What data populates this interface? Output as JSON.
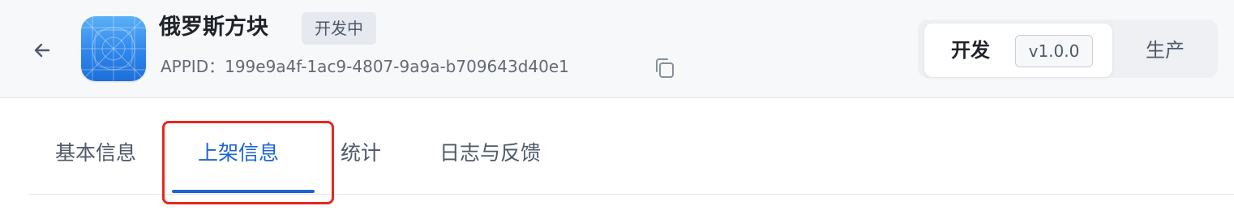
{
  "header": {
    "app_name": "俄罗斯方块",
    "status": "开发中",
    "appid_label": "APPID：",
    "appid_value": "199e9a4f-1ac9-4807-9a9a-b709643d40e1"
  },
  "env_switch": {
    "dev_label": "开发",
    "dev_version": "v1.0.0",
    "prod_label": "生产",
    "selected": "开发"
  },
  "tabs": [
    {
      "label": "基本信息",
      "active": false
    },
    {
      "label": "上架信息",
      "active": true
    },
    {
      "label": "统计",
      "active": false
    },
    {
      "label": "日志与反馈",
      "active": false
    }
  ],
  "icons": {
    "back": "arrow-left-icon",
    "copy": "copy-icon",
    "app": "app-icon"
  },
  "colors": {
    "accent": "#1d64d6",
    "highlight": "#e8271c",
    "header_bg": "#f7f8fa"
  }
}
